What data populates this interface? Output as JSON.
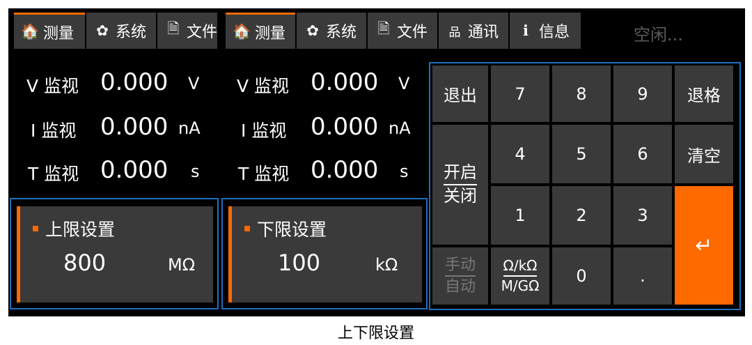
{
  "tabs_left": [
    {
      "icon": "home-icon",
      "glyph": "🏠",
      "label": "测量"
    },
    {
      "icon": "gear-icon",
      "glyph": "✿",
      "label": "系统"
    },
    {
      "icon": "file-icon",
      "glyph": "🗎",
      "label": "文件"
    }
  ],
  "tabs_right": [
    {
      "icon": "home-icon",
      "glyph": "🏠",
      "label": "测量"
    },
    {
      "icon": "gear-icon",
      "glyph": "✿",
      "label": "系统"
    },
    {
      "icon": "file-icon",
      "glyph": "🗎",
      "label": "文件"
    },
    {
      "icon": "network-icon",
      "glyph": "品",
      "label": "通讯"
    },
    {
      "icon": "info-icon",
      "glyph": "ℹ",
      "label": "信息"
    }
  ],
  "status": "空闲...",
  "monitors_left": [
    {
      "label": "V 监视",
      "value": "0.000",
      "unit": "V"
    },
    {
      "label": "I 监视",
      "value": "0.000",
      "unit": "nA"
    },
    {
      "label": "T 监视",
      "value": "0.000",
      "unit": "s"
    }
  ],
  "monitors_right": [
    {
      "label": "V 监视",
      "value": "0.000",
      "unit": "V"
    },
    {
      "label": "I 监视",
      "value": "0.000",
      "unit": "nA"
    },
    {
      "label": "T 监视",
      "value": "0.000",
      "unit": "s"
    }
  ],
  "upper_limit": {
    "title": "上限设置",
    "value": "800",
    "unit": "MΩ"
  },
  "lower_limit": {
    "title": "下限设置",
    "value": "100",
    "unit": "kΩ"
  },
  "keypad": {
    "exit": "退出",
    "backspace": "退格",
    "clear": "清空",
    "on": "开启",
    "off": "关闭",
    "manual": "手动",
    "auto": "自动",
    "unit_small": "Ω/kΩ",
    "unit_large": "M/GΩ",
    "d7": "7",
    "d8": "8",
    "d9": "9",
    "d4": "4",
    "d5": "5",
    "d6": "6",
    "d1": "1",
    "d2": "2",
    "d3": "3",
    "d0": "0",
    "dot": ".",
    "enter": "↵"
  },
  "caption": "上下限设置",
  "colors": {
    "accent": "#ff6a00",
    "panel": "#3a3a3a",
    "border": "#1f6fbf",
    "background": "#000000"
  }
}
